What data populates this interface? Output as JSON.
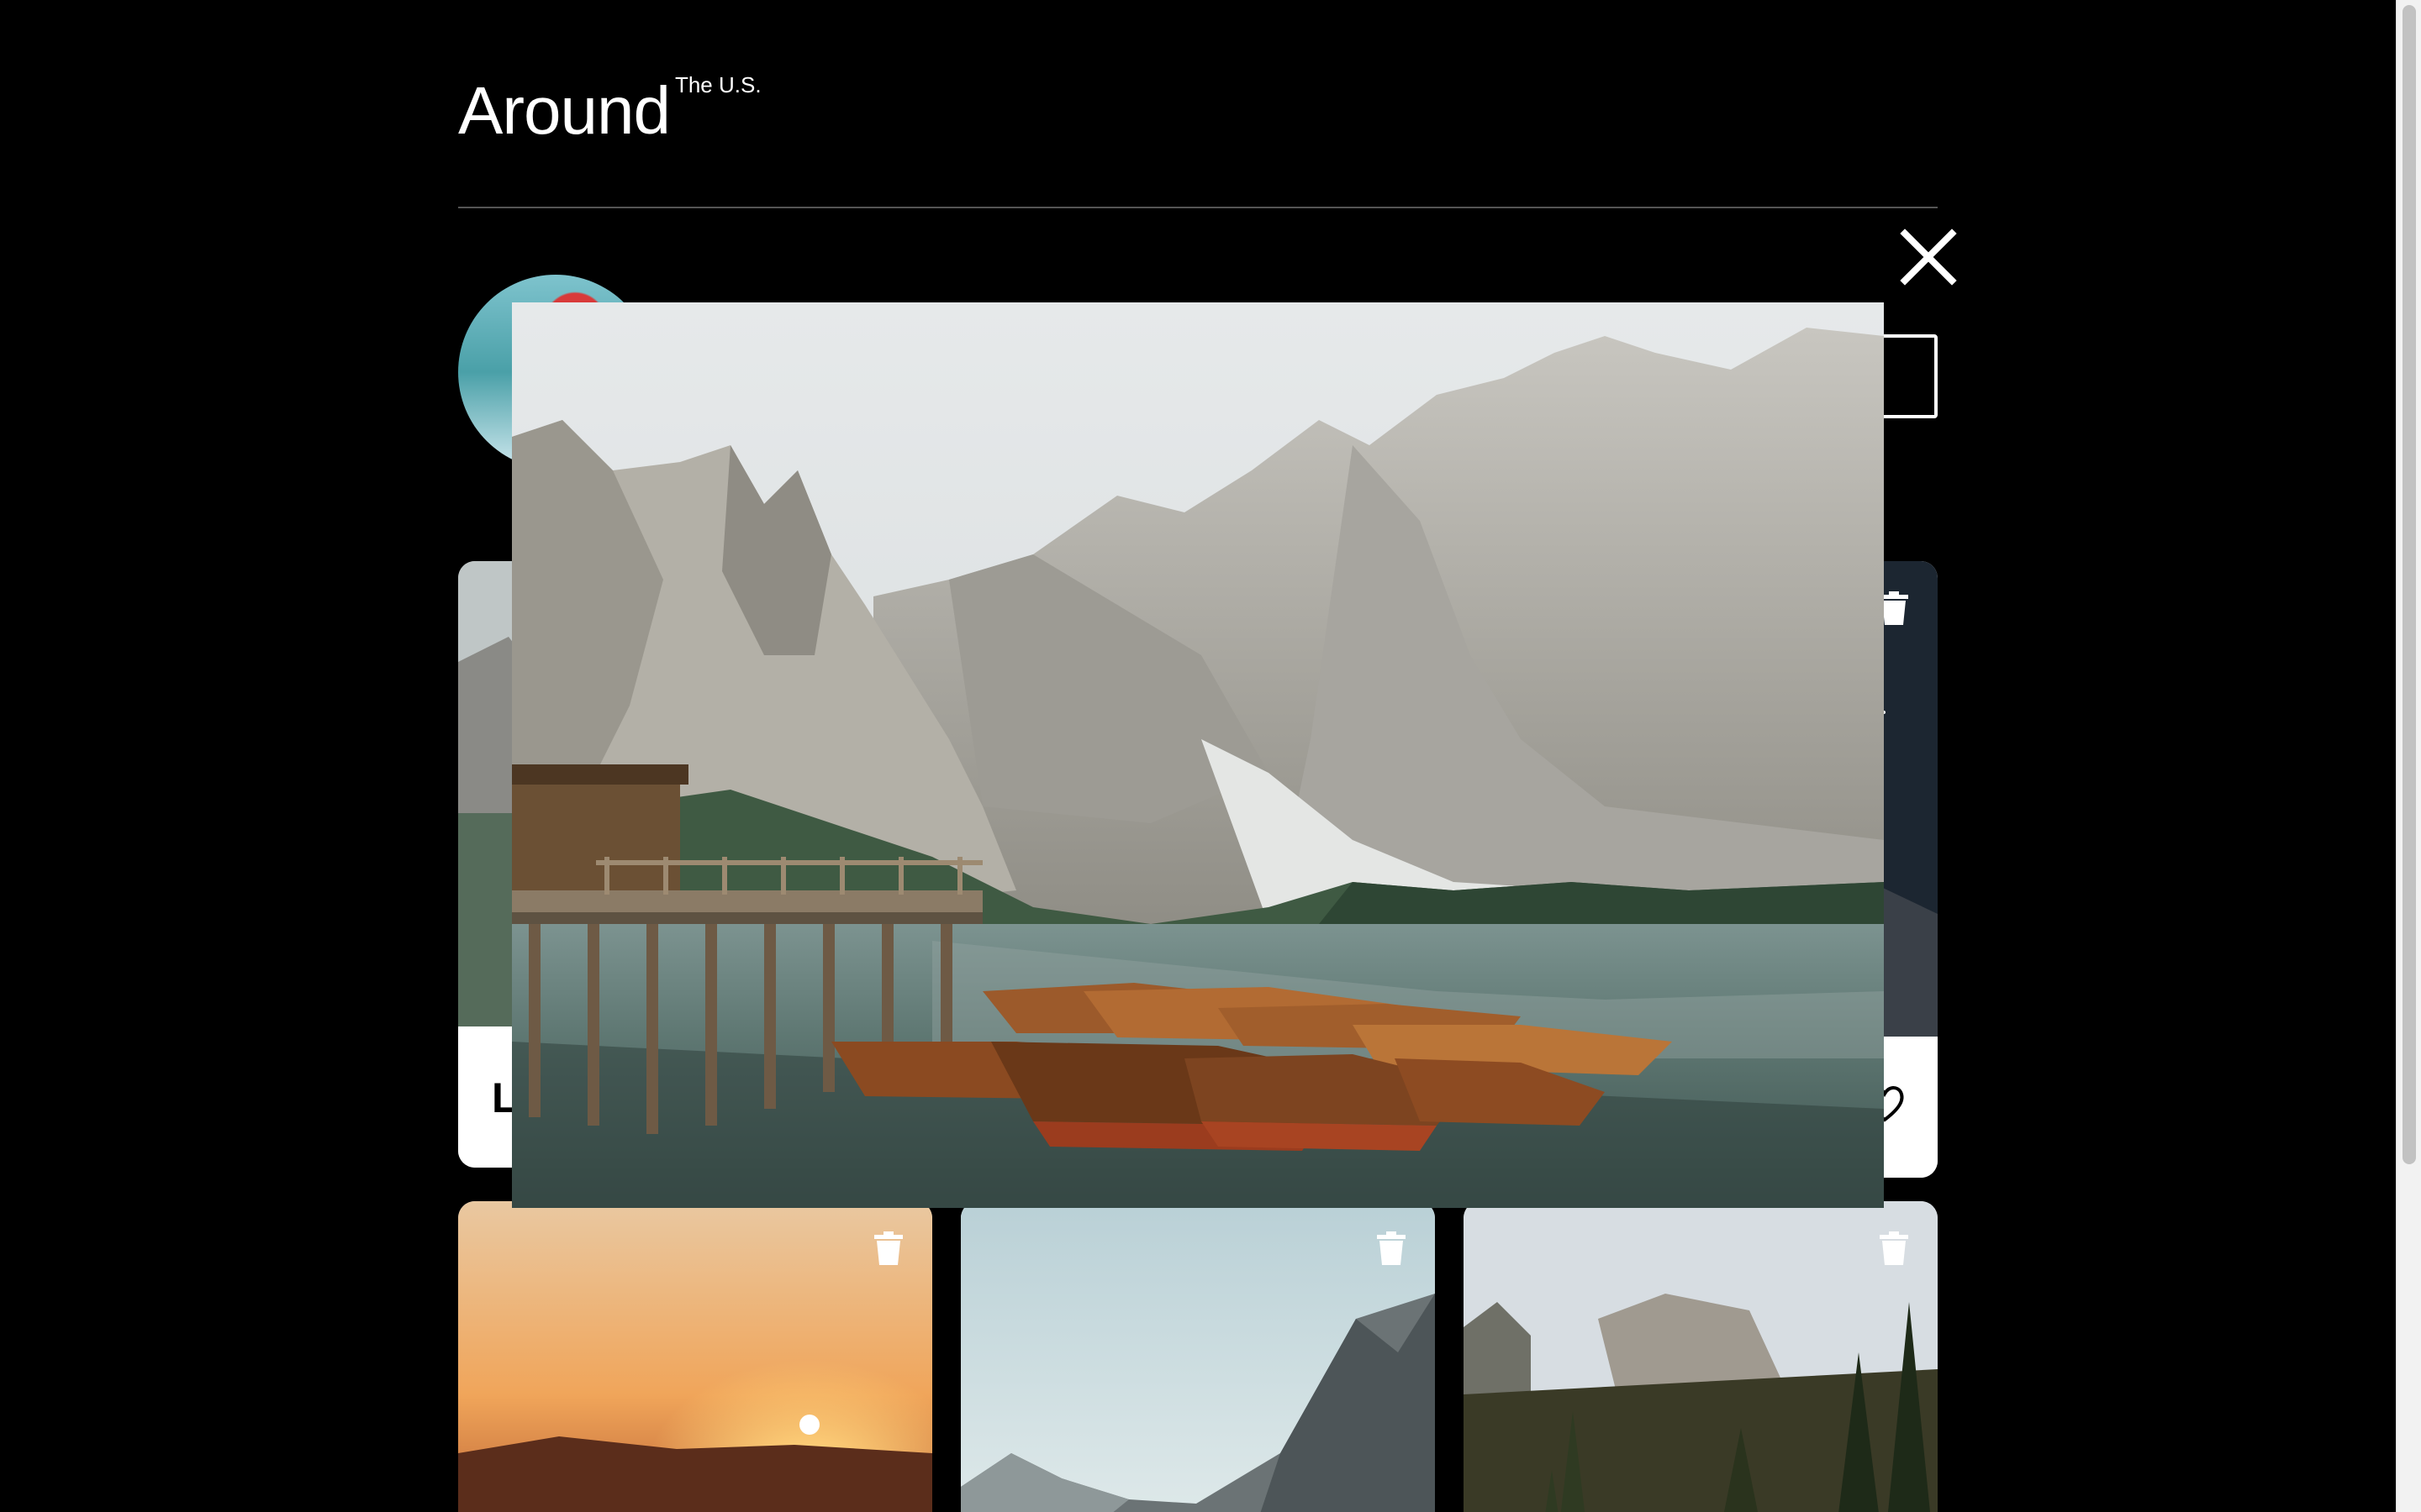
{
  "header": {
    "logo_main": "Around",
    "logo_sup": "The U.S."
  },
  "cards_row1": [
    {
      "title": "L"
    }
  ],
  "popup": {
    "close_icon": "close-icon"
  },
  "icons": {
    "trash": "trash-icon",
    "like": "heart-icon",
    "close": "close-icon"
  }
}
